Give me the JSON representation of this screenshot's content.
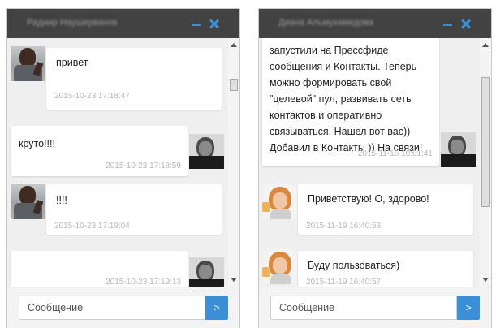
{
  "chats": [
    {
      "title": "Радиир Наушерванов",
      "input_placeholder": "Сообщение",
      "send_label": ">",
      "messages": [
        {
          "text": "привет",
          "time": "2015-10-23 17:18:47",
          "sender": "contact"
        },
        {
          "text": "круто!!!!",
          "time": "2015-10-23 17:18:59",
          "sender": "self"
        },
        {
          "text": "!!!!",
          "time": "2015-10-23 17:19:04",
          "sender": "contact"
        },
        {
          "text": "",
          "time": "2015-10-23 17:19:13",
          "sender": "self"
        }
      ]
    },
    {
      "title": "Диана Альмухамедова",
      "input_placeholder": "Сообщение",
      "send_label": ">",
      "messages": [
        {
          "lines": [
            "запустили на Прессфиде",
            "сообщения и Контакты. Теперь",
            "можно формировать свой",
            "\"целевой\" пул, развивать сеть",
            "контактов и оперативно",
            "связываться. Нашел вот вас))",
            "Добавил в Контакты )) На связи!"
          ],
          "time": "2015-11-16 10:01:41",
          "sender": "self"
        },
        {
          "text": "Приветствую! О, здорово!",
          "time": "2015-11-19 16:40:53",
          "sender": "contact"
        },
        {
          "text": "Буду пользоваться)",
          "time": "2015-11-19 16:40:57",
          "sender": "contact"
        }
      ]
    }
  ],
  "colors": {
    "header": "#424242",
    "accent": "#3a8fd6",
    "panel": "#efefef"
  },
  "icons": {
    "minimize": "minus-icon",
    "close": "close-icon"
  }
}
